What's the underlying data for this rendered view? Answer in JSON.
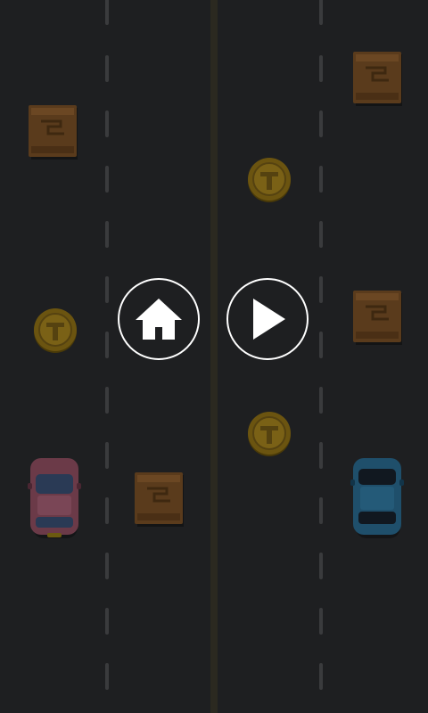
{
  "screen": "pause-menu",
  "colors": {
    "road": "#1e1f21",
    "lane_dash": "#3a3b3d",
    "center_line": "#2b2920",
    "crate": "#5a3b1c",
    "coin": "#6b5410",
    "player_car": "#1f4f6b",
    "enemy_car": "#6b3a48",
    "button": "#ffffff"
  },
  "buttons": {
    "home": {
      "icon": "home-icon"
    },
    "play": {
      "icon": "play-icon"
    }
  },
  "objects": {
    "crates": 4,
    "coins": 3,
    "cars": 2
  }
}
